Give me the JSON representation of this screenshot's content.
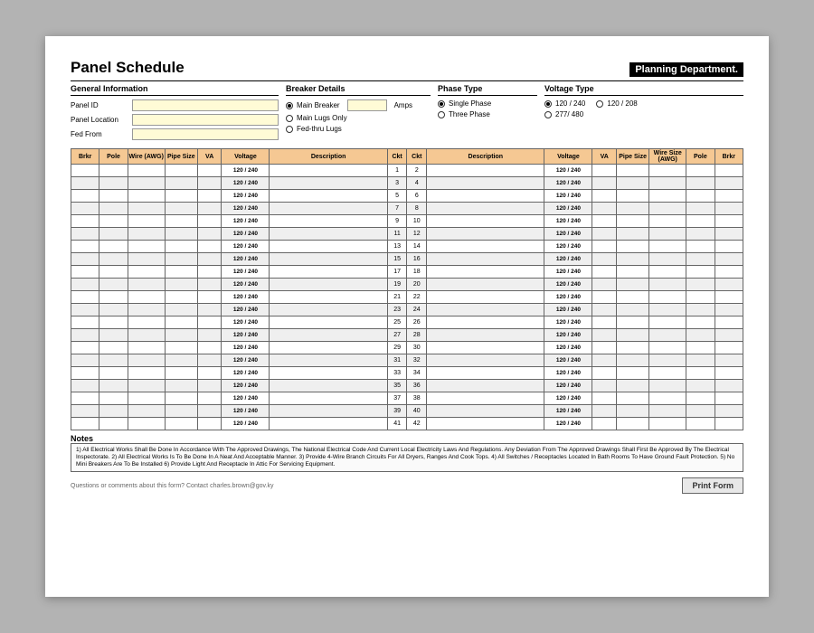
{
  "title": "Panel Schedule",
  "dept_label": "Planning Department.",
  "sections": {
    "general_info": "General Information",
    "breaker_details": "Breaker Details",
    "phase_type": "Phase Type",
    "voltage_type": "Voltage Type"
  },
  "fields": {
    "panel_id": "Panel ID",
    "panel_location": "Panel Location",
    "fed_from": "Fed From",
    "amps": "Amps"
  },
  "breaker_options": {
    "main_breaker": "Main Breaker",
    "main_lugs_only": "Main Lugs Only",
    "fed_thru_lugs": "Fed-thru Lugs"
  },
  "phase_options": {
    "single": "Single Phase",
    "three": "Three Phase"
  },
  "voltage_options": {
    "v120_240": "120 / 240",
    "v120_208": "120 / 208",
    "v277_480": "277/ 480"
  },
  "columns": {
    "brkr": "Brkr",
    "pole": "Pole",
    "wire_awg": "Wire\n(AWG)",
    "pipe_size": "Pipe\nSize",
    "va": "VA",
    "voltage": "Voltage",
    "description": "Description",
    "ckt": "Ckt",
    "wire_size_awg": "Wire Size\n(AWG)"
  },
  "row_voltage": "120 / 240",
  "rows": [
    [
      1,
      2
    ],
    [
      3,
      4
    ],
    [
      5,
      6
    ],
    [
      7,
      8
    ],
    [
      9,
      10
    ],
    [
      11,
      12
    ],
    [
      13,
      14
    ],
    [
      15,
      16
    ],
    [
      17,
      18
    ],
    [
      19,
      20
    ],
    [
      21,
      22
    ],
    [
      23,
      24
    ],
    [
      25,
      26
    ],
    [
      27,
      28
    ],
    [
      29,
      30
    ],
    [
      31,
      32
    ],
    [
      33,
      34
    ],
    [
      35,
      36
    ],
    [
      37,
      38
    ],
    [
      39,
      40
    ],
    [
      41,
      42
    ]
  ],
  "notes_label": "Notes",
  "notes_text": "1) All Electrical Works Shall Be Done In Accordance With The Approved Drawings, The National Electrical Code And Current Local Electricity Laws And Regulations. Any Deviation From The Approved Drawings Shall First Be Approved By The Electrical Inspectorate.  2) All Electrical Works Is To Be Done In A Neat And Acceptable Manner.  3) Provide 4-Wire Branch Circuits For All Dryers, Ranges And Cook Tops.  4) All Switches / Receptacles Located In Bath Rooms To Have Ground Fault Protection.  5) No Mini Breakers Are To Be Installed  6) Provide Light And Receptacle In Attic For Servicing Equipment.",
  "footer_contact": "Questions or comments about this form? Contact charles.brown@gov.ky",
  "print_label": "Print Form"
}
